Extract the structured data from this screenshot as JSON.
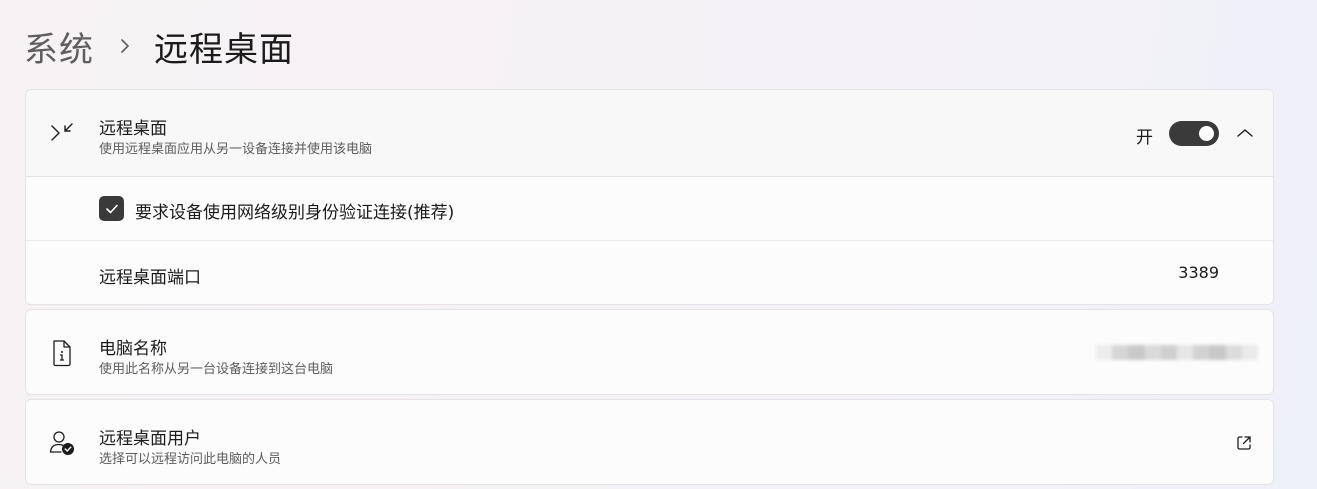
{
  "breadcrumb": {
    "parent": "系统",
    "current": "远程桌面"
  },
  "remote_desktop": {
    "title": "远程桌面",
    "subtitle": "使用远程桌面应用从另一设备连接并使用该电脑",
    "toggle_state_label": "开",
    "toggle_on": true,
    "expanded": true,
    "icon": "remote-desktop-icon",
    "nla_checkbox": {
      "label": "要求设备使用网络级别身份验证连接(推荐)",
      "checked": true
    },
    "port": {
      "label": "远程桌面端口",
      "value": "3389"
    }
  },
  "pc_name": {
    "title": "电脑名称",
    "subtitle": "使用此名称从另一台设备连接到这台电脑",
    "icon": "pc-info-icon",
    "value_blurred": true
  },
  "remote_users": {
    "title": "远程桌面用户",
    "subtitle": "选择可以远程访问此电脑的人员",
    "icon": "user-check-icon",
    "action_icon": "open-external-icon"
  },
  "colors": {
    "accent_toggle": "#3a3a3a",
    "card_background": "#fdfcfd",
    "subtitle_text": "#5d5d5d"
  }
}
